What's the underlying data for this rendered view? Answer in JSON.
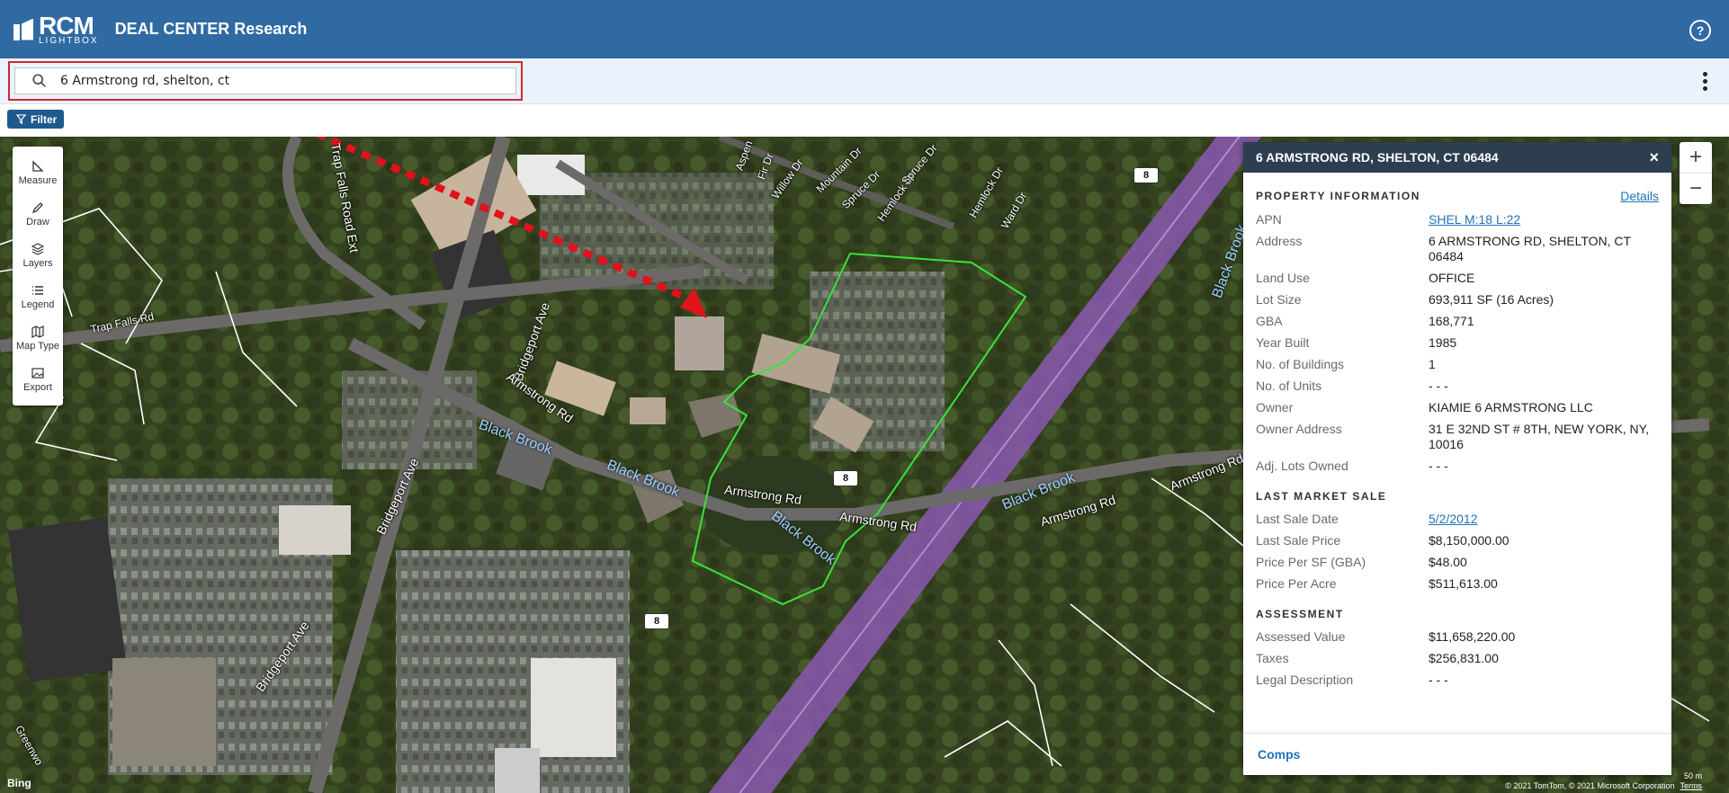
{
  "header": {
    "logo_main": "RCM",
    "logo_sub": "LIGHTBOX",
    "title": "DEAL CENTER Research",
    "help_glyph": "?"
  },
  "search": {
    "value": "6 Armstrong rd, shelton, ct",
    "icon": "search-icon"
  },
  "filter": {
    "label": "Filter",
    "icon": "filter-icon"
  },
  "toolbar": {
    "items": [
      {
        "label": "Measure",
        "icon": "ruler-icon"
      },
      {
        "label": "Draw",
        "icon": "pencil-icon"
      },
      {
        "label": "Layers",
        "icon": "layers-icon"
      },
      {
        "label": "Legend",
        "icon": "list-icon"
      },
      {
        "label": "Map Type",
        "icon": "map-icon"
      },
      {
        "label": "Export",
        "icon": "image-icon"
      }
    ]
  },
  "zoom": {
    "in": "+",
    "out": "−"
  },
  "map": {
    "roads": [
      "Trap Falls Road Ext",
      "Trap Falls Rd",
      "Bridgeport Ave",
      "Bridgeport Ave",
      "Bridgeport Ave",
      "Armstrong Rd",
      "Armstrong Rd",
      "Armstrong Rd",
      "Armstrong Rd",
      "Armstrong Rd",
      "Aspen",
      "Fir Dr",
      "Willow Dr",
      "Mountain Dr",
      "Spruce Dr",
      "Hemlock Dr",
      "Spruce Dr",
      "Hemlock Dr",
      "Ward Dr",
      "Greenwo"
    ],
    "water": [
      "Black Brook",
      "Black Brook",
      "Black Brook",
      "Black Brook",
      "Black Brook"
    ],
    "shields": [
      "8",
      "8",
      "8"
    ],
    "attribution": "© 2021 TomTom, © 2021 Microsoft Corporation",
    "terms": "Terms",
    "scale": "50 m",
    "bing": "Bing"
  },
  "panel": {
    "title": "6 ARMSTRONG RD, SHELTON, CT 06484",
    "close": "×",
    "property_info": {
      "heading": "PROPERTY INFORMATION",
      "details_link": "Details",
      "rows": [
        {
          "k": "APN",
          "v": "SHEL M:18 L:22",
          "link": true
        },
        {
          "k": "Address",
          "v": "6 ARMSTRONG RD, SHELTON, CT 06484"
        },
        {
          "k": "Land Use",
          "v": "OFFICE"
        },
        {
          "k": "Lot Size",
          "v": "693,911 SF (16 Acres)"
        },
        {
          "k": "GBA",
          "v": "168,771"
        },
        {
          "k": "Year Built",
          "v": "1985"
        },
        {
          "k": "No. of Buildings",
          "v": "1"
        },
        {
          "k": "No. of Units",
          "v": "- - -"
        },
        {
          "k": "Owner",
          "v": "KIAMIE 6 ARMSTRONG LLC"
        },
        {
          "k": "Owner Address",
          "v": "31 E 32ND ST # 8TH, NEW YORK, NY, 10016"
        },
        {
          "k": "Adj. Lots Owned",
          "v": "- - -"
        }
      ]
    },
    "last_market_sale": {
      "heading": "LAST MARKET SALE",
      "rows": [
        {
          "k": "Last Sale Date",
          "v": "5/2/2012",
          "link": true
        },
        {
          "k": "Last Sale Price",
          "v": "$8,150,000.00"
        },
        {
          "k": "Price Per SF (GBA)",
          "v": "$48.00"
        },
        {
          "k": "Price Per Acre",
          "v": "$511,613.00"
        }
      ]
    },
    "assessment": {
      "heading": "ASSESSMENT",
      "rows": [
        {
          "k": "Assessed Value",
          "v": "$11,658,220.00"
        },
        {
          "k": "Taxes",
          "v": "$256,831.00"
        },
        {
          "k": "Legal Description",
          "v": "- - -"
        }
      ]
    },
    "footer": {
      "comps": "Comps"
    }
  },
  "colors": {
    "header_bg": "#2f6aa3",
    "search_band": "#eaf2fb",
    "highlight_red": "#d0262f",
    "parcel_outline": "#2ecc2e",
    "highway": "#8a58b0",
    "link": "#1f73b7"
  }
}
